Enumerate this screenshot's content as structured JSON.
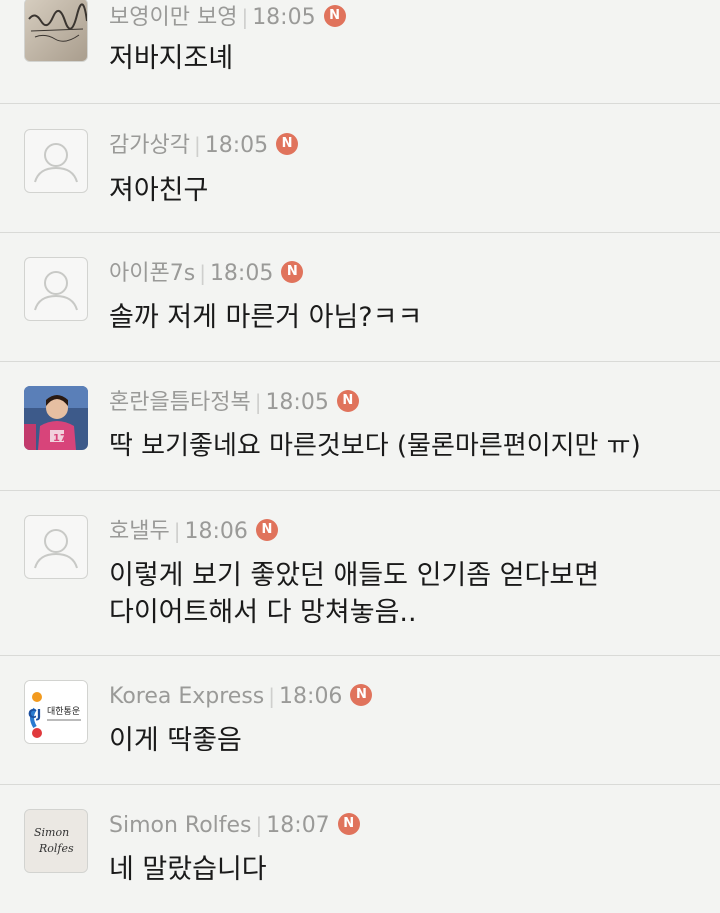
{
  "comments": [
    {
      "author": "보영이만 보영",
      "time": "18:05",
      "badge": "N",
      "text": [
        "저바지조녜"
      ],
      "avatar": "photo-handwriting",
      "avatar_text": "보영이 막보영"
    },
    {
      "author": "감가상각",
      "time": "18:05",
      "badge": "N",
      "text": [
        "져아친구"
      ],
      "avatar": "default"
    },
    {
      "author": "아이폰7s",
      "time": "18:05",
      "badge": "N",
      "text": [
        "솔까 저게 마른거 아님?ㅋㅋ"
      ],
      "avatar": "default"
    },
    {
      "author": "혼란을틈타정복",
      "time": "18:05",
      "badge": "N",
      "text": [
        "딱 보기좋네요 마른것보다 (물론마른편이지만 ㅠ)"
      ],
      "avatar": "photo-athlete",
      "avatar_text": "17"
    },
    {
      "author": "호낼두",
      "time": "18:06",
      "badge": "N",
      "text": [
        "이렇게 보기 좋았던 애들도 인기좀 얻다보면",
        "다이어트해서 다 망쳐놓음.."
      ],
      "avatar": "default"
    },
    {
      "author": "Korea Express",
      "time": "18:06",
      "badge": "N",
      "text": [
        "이게 딱좋음"
      ],
      "avatar": "cj-logo",
      "avatar_text": "대한통운"
    },
    {
      "author": "Simon Rolfes",
      "time": "18:07",
      "badge": "N",
      "text": [
        "네 말랐습니다"
      ],
      "avatar": "signature",
      "avatar_text": "Simon Rolfes"
    }
  ],
  "colors": {
    "badge": "#e0735c",
    "background": "#f3f4f2",
    "meta": "#9a9a98",
    "divider": "#d9dad7"
  }
}
